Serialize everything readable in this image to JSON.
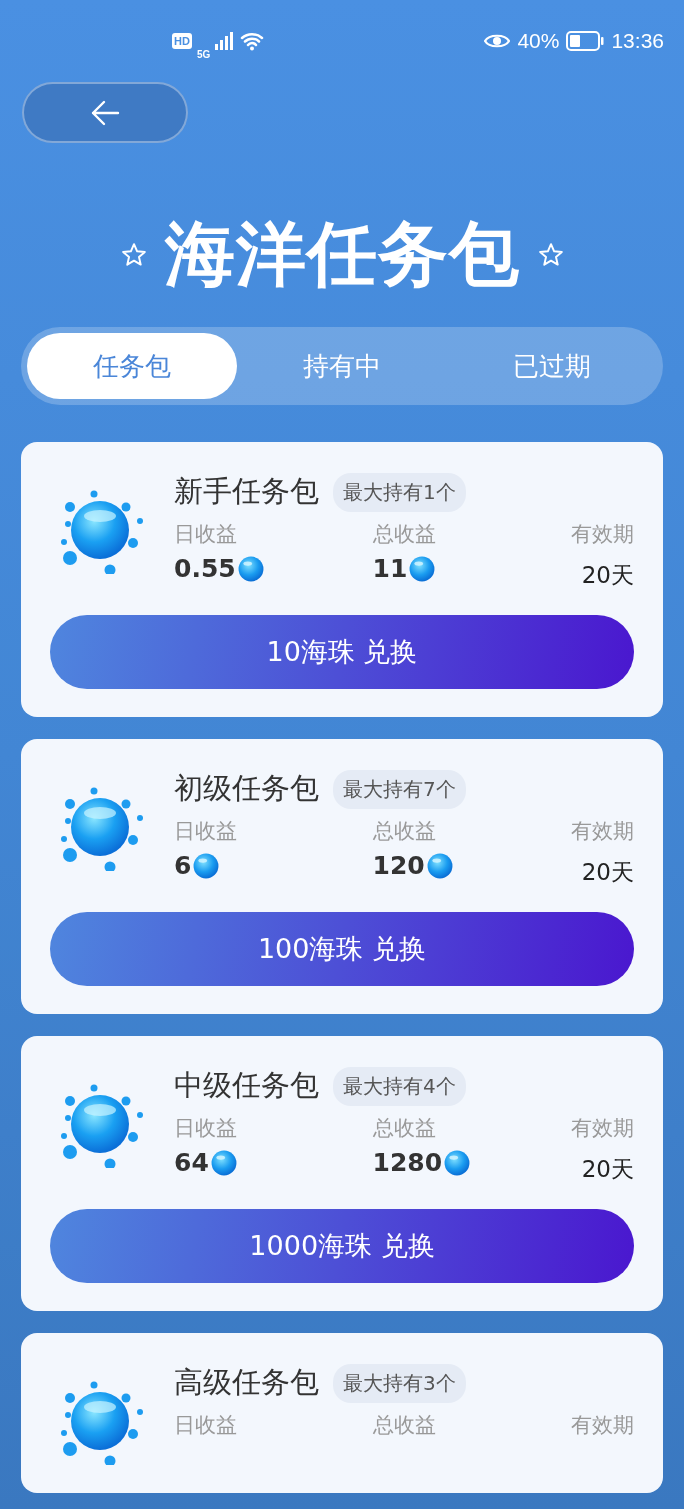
{
  "status_bar": {
    "hd": "HD",
    "network": "5G",
    "battery": "40%",
    "time": "13:36"
  },
  "title": "海洋任务包",
  "tabs": [
    {
      "label": "任务包",
      "selected": true
    },
    {
      "label": "持有中",
      "selected": false
    },
    {
      "label": "已过期",
      "selected": false
    }
  ],
  "packages": [
    {
      "name": "新手任务包",
      "limit": "最大持有1个",
      "daily_label": "日收益",
      "daily": "0.55",
      "total_label": "总收益",
      "total": "11",
      "validity_label": "有效期",
      "validity": "20天",
      "button": "10海珠 兑换"
    },
    {
      "name": "初级任务包",
      "limit": "最大持有7个",
      "daily_label": "日收益",
      "daily": "6",
      "total_label": "总收益",
      "total": "120",
      "validity_label": "有效期",
      "validity": "20天",
      "button": "100海珠 兑换"
    },
    {
      "name": "中级任务包",
      "limit": "最大持有4个",
      "daily_label": "日收益",
      "daily": "64",
      "total_label": "总收益",
      "total": "1280",
      "validity_label": "有效期",
      "validity": "20天",
      "button": "1000海珠 兑换"
    },
    {
      "name": "高级任务包",
      "limit": "最大持有3个",
      "daily_label": "日收益",
      "total_label": "总收益",
      "validity_label": "有效期"
    }
  ]
}
